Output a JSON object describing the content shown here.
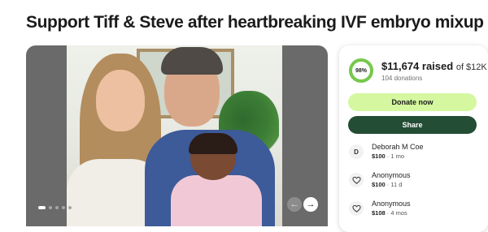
{
  "page": {
    "title": "Support Tiff & Steve after heartbreaking IVF embryo mixup"
  },
  "carousel": {
    "prev_icon": "←",
    "next_icon": "→",
    "slide_count": 5,
    "active_slide": 1
  },
  "donation": {
    "progress_percent_label": "98%",
    "progress_fraction": 0.98,
    "raised": "$11,674 raised",
    "goal": "of $12K",
    "donations_count": "104 donations",
    "donate_label": "Donate now",
    "share_label": "Share",
    "colors": {
      "ring": "#77c84c",
      "ring_track": "#e4f3d4",
      "donate_bg": "#d4f7a0",
      "share_bg": "#234d34"
    }
  },
  "donors": [
    {
      "initial": "D",
      "icon": "avatar-initial",
      "name": "Deborah M Coe",
      "amount": "$100",
      "time": "1 mo"
    },
    {
      "initial": "",
      "icon": "heart-hand-icon",
      "name": "Anonymous",
      "amount": "$100",
      "time": "11 d"
    },
    {
      "initial": "",
      "icon": "heart-hand-icon",
      "name": "Anonymous",
      "amount": "$108",
      "time": "4 mos"
    }
  ]
}
